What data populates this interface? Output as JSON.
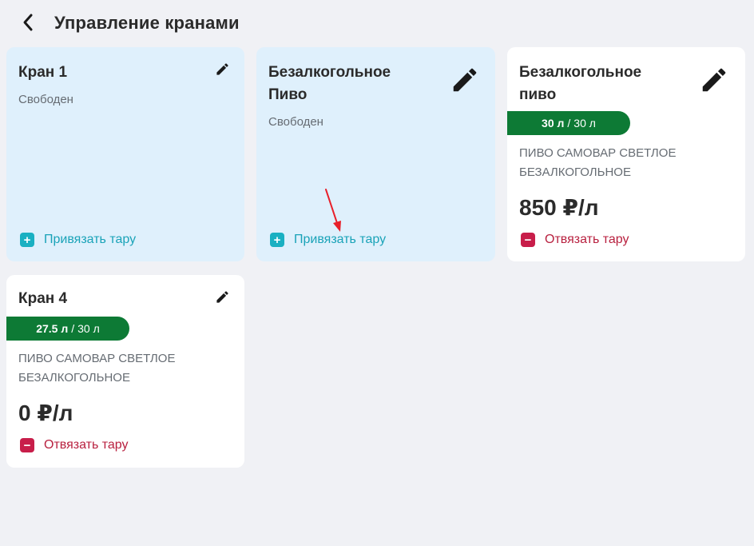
{
  "header": {
    "title": "Управление кранами",
    "back_icon": "chevron-left-icon"
  },
  "taps": [
    {
      "name": "Кран 1",
      "status": "Свободен",
      "action_label": "Привязать тару",
      "state": "free"
    },
    {
      "name_line1": "Безалкогольное",
      "name_line2": "Пиво",
      "status": "Свободен",
      "action_label": "Привязать тару",
      "state": "free"
    },
    {
      "name_line1": "Безалкогольное",
      "name_line2": "пиво",
      "volume_current": "30 л",
      "volume_separator": "/",
      "volume_total": "30 л",
      "product_line1": "ПИВО САМОВАР СВЕТЛОЕ",
      "product_line2": "БЕЗАЛКОГОЛЬНОЕ",
      "price": "850 ₽/л",
      "action_label": "Отвязать тару",
      "state": "busy"
    },
    {
      "name": "Кран 4",
      "volume_current": "27.5 л",
      "volume_separator": "/",
      "volume_total": "30 л",
      "product_line1": "ПИВО САМОВАР СВЕТЛОЕ",
      "product_line2": "БЕЗАЛКОГОЛЬНОЕ",
      "price": "0 ₽/л",
      "action_label": "Отвязать тару",
      "state": "busy"
    }
  ],
  "colors": {
    "background": "#f0f1f5",
    "free_card": "#dff0fc",
    "bind_action": "#1aa3b8",
    "unbind_action": "#b8203f",
    "volume_pill": "#0d7a35",
    "annotation_arrow": "#e8202a"
  },
  "icons": {
    "edit": "pencil-icon",
    "bind": "plus-square-icon",
    "unbind": "minus-square-icon"
  }
}
